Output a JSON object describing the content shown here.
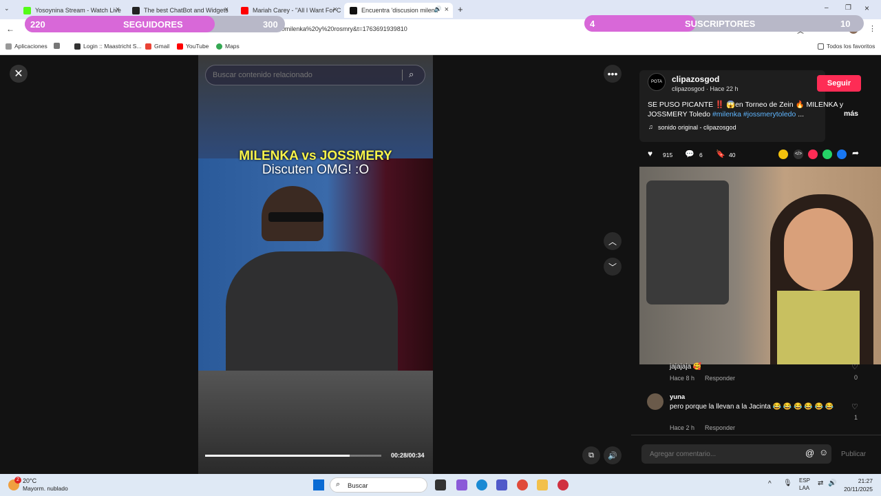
{
  "tabs": [
    {
      "title": "Yosoynina Stream - Watch Live"
    },
    {
      "title": "The best ChatBot and Widgets"
    },
    {
      "title": "Mariah Carey - \"All I Want For C"
    },
    {
      "title": "Encuentra 'discusion milenk"
    }
  ],
  "address": {
    "url": "965027q=discusion%20%20milenka%20y%20rosmry&t=1763691939810"
  },
  "bookmarks": [
    "Aplicaciones",
    "Login :: Maastricht S...",
    "Gmail",
    "YouTube",
    "Maps"
  ],
  "all_bookmarks": "Todos los favoritos",
  "overlay": {
    "followers_count": "220",
    "followers_label": "SEGUIDORES",
    "followers_goal": "300",
    "followers_progress": 0.73,
    "subs_count": "4",
    "subs_label": "SUSCRIPTORES",
    "subs_goal": "10",
    "subs_progress": 0.4
  },
  "search": {
    "placeholder": "Buscar contenido relacionado"
  },
  "video": {
    "caption_line1": "MILENKA vs JOSSMERY",
    "caption_line2": "Discuten OMG! :O",
    "time": "00:28/00:34",
    "progress": 0.82
  },
  "post": {
    "username": "clipazosgod",
    "meta": "clipazosgod · Hace 22 h",
    "follow": "Seguir",
    "desc_a": "SE PUSO PICANTE ‼️ 😱en Torneo de Zein 🔥 MILENKA y JOSSMERY Toledo ",
    "tags": "#milenka #jossmerytoledo",
    "desc_more": "...",
    "more": "más",
    "sound": "sonido original - clipazosgod",
    "likes": "915",
    "comments": "6",
    "saves": "40"
  },
  "comments": [
    {
      "text": "jajajaja 🥰",
      "time": "Hace 8 h",
      "reply": "Responder",
      "likes": "0"
    },
    {
      "user": "yuna",
      "text": "pero porque la llevan a la Jacinta 😂 😂 😂 😂 😂 😂",
      "time": "Hace 2 h",
      "reply": "Responder",
      "likes": "1"
    }
  ],
  "comment_input": {
    "placeholder": "Agregar comentario...",
    "publish": "Publicar"
  },
  "taskbar": {
    "temp": "20°C",
    "weather": "Mayorm. nublado",
    "weather_badge": "2",
    "search": "Buscar",
    "lang1": "ESP",
    "lang2": "LAA",
    "time": "21:27",
    "date": "20/11/2025"
  },
  "colors": {
    "accent": "#fe2c55",
    "pill": "#d868d8",
    "hashtag": "#5fb6ff"
  }
}
